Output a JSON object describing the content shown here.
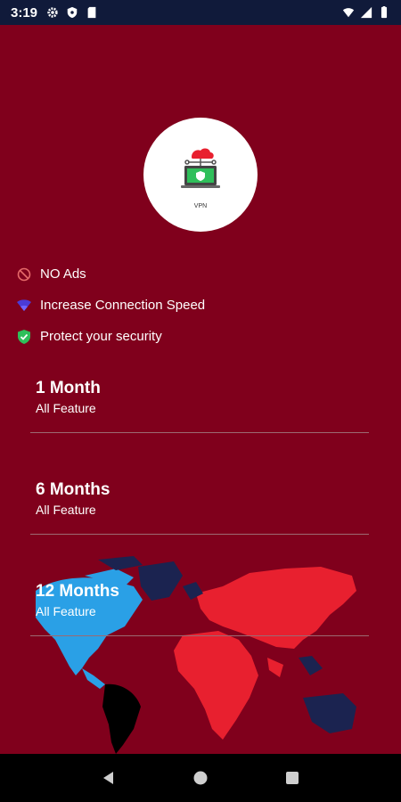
{
  "status_bar": {
    "time": "3:19",
    "left_icons": [
      "gear-icon",
      "shield-icon",
      "sd-card-icon"
    ],
    "right_icons": [
      "wifi-icon",
      "signal-icon",
      "battery-icon"
    ]
  },
  "logo": {
    "caption": "VPN",
    "icon": "vpn-laptop-cloud-icon"
  },
  "features": [
    {
      "label": "NO Ads",
      "icon": "no-ads-icon",
      "color": "#e56a6a"
    },
    {
      "label": "Increase Connection Speed",
      "icon": "wifi-speed-icon",
      "color": "#4b3bd6"
    },
    {
      "label": "Protect your security",
      "icon": "shield-check-icon",
      "color": "#2fbf5a"
    }
  ],
  "plans": [
    {
      "title": "1 Month",
      "subtitle": "All Feature"
    },
    {
      "title": "6 Months",
      "subtitle": "All Feature"
    },
    {
      "title": "12 Months",
      "subtitle": "All Feature"
    }
  ],
  "colors": {
    "background": "#80001c",
    "status_bar": "#101a3a",
    "map_americas": "#2aa0e6",
    "map_eurasia_africa": "#e8202f",
    "map_south_america": "#000000",
    "map_dark": "#1b2350"
  },
  "nav": {
    "back": "back-icon",
    "home": "home-icon",
    "recents": "recents-icon"
  }
}
